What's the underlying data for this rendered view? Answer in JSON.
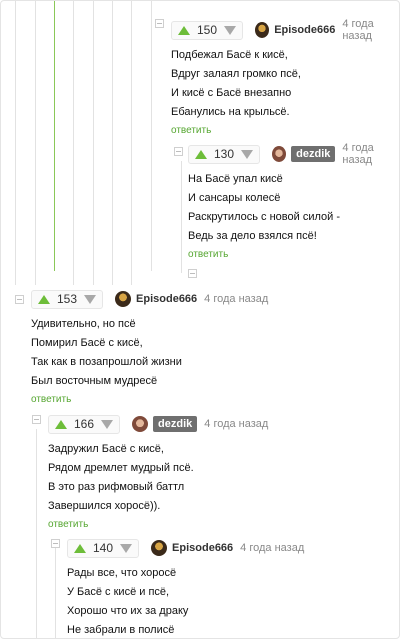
{
  "colors": {
    "accent": "#6dbd39",
    "reply": "#55a630",
    "thread_line": "#8ac858"
  },
  "comments": [
    {
      "rating": "150",
      "author": "Episode666",
      "time": "4 года назад",
      "lines": [
        "Подбежал Басё к кисё,",
        "Вдруг залаял громко псё,",
        "И кисё с Басё внезапно",
        "Ебанулись на крыльсё."
      ],
      "reply": "ответить"
    },
    {
      "rating": "130",
      "author": "dezdik",
      "time": "4 года назад",
      "lines": [
        "На Басё упал кисё",
        "И сансары колесё",
        "Раскрутилось с новой силой -",
        "Ведь за дело взялся псё!"
      ],
      "reply": "ответить"
    },
    {
      "rating": "153",
      "author": "Episode666",
      "time": "4 года назад",
      "lines": [
        "Удивительно, но псё",
        "Помирил Басё с кисё,",
        "Так как в позапрошлой жизни",
        "Был восточным мудресё"
      ],
      "reply": "ответить"
    },
    {
      "rating": "166",
      "author": "dezdik",
      "time": "4 года назад",
      "lines": [
        "Задружил Басё с кисё,",
        "Рядом дремлет мудрый псё.",
        "В это раз рифмовый баттл",
        "Завершился хоросё))."
      ],
      "reply": "ответить"
    },
    {
      "rating": "140",
      "author": "Episode666",
      "time": "4 года назад",
      "lines": [
        "Рады все, что хоросё",
        "У Басё с кисё и псё,",
        "Хорошо что их за драку",
        "Не забрали в полисё"
      ],
      "reply": ""
    }
  ]
}
